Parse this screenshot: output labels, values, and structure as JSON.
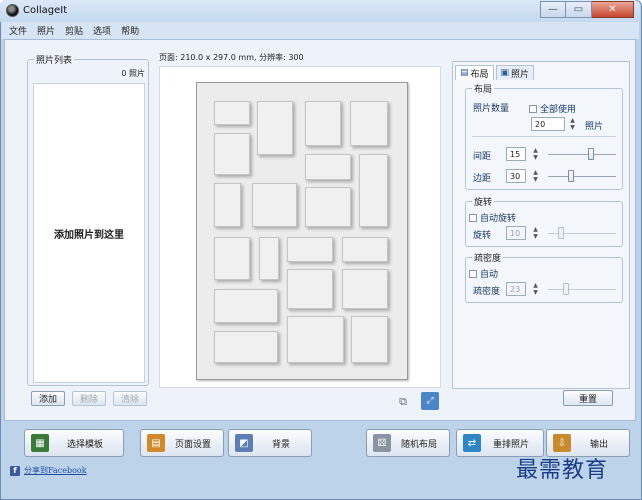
{
  "window": {
    "title": "CollageIt",
    "minimize": "—",
    "maximize": "▭",
    "close": "✕"
  },
  "menu": [
    "文件",
    "照片",
    "剪贴",
    "选项",
    "帮助"
  ],
  "photo_list": {
    "title": "照片列表",
    "count": "0 照片",
    "drop_hint": "添加照片到这里",
    "add": "添加",
    "remove": "删除",
    "clear": "清除"
  },
  "page_info": "页面: 210.0 x 297.0 mm, 分辨率: 300",
  "tabs": {
    "layout": "布局",
    "photo": "照片"
  },
  "layout_group": {
    "title": "布局",
    "photo_count_label": "照片数量",
    "use_all": "全部使用",
    "photo_count": "20",
    "photo_unit": "照片",
    "spacing_label": "间距",
    "spacing": "15",
    "margin_label": "边距",
    "margin": "30"
  },
  "rotation_group": {
    "title": "旋转",
    "auto": "自动旋转",
    "rotation_label": "旋转",
    "rotation": "10"
  },
  "density_group": {
    "title": "疏密度",
    "auto": "自动",
    "density_label": "疏密度",
    "density": "23"
  },
  "reset": "重置",
  "bottom": {
    "template": "选择模板",
    "page_setup": "页面设置",
    "background": "背景",
    "random_layout": "随机布局",
    "rearrange": "重排照片",
    "export": "输出"
  },
  "share": "分享到Facebook",
  "watermark": "最需教育",
  "icons": {
    "template": "template-icon",
    "page_setup": "page-setup-icon",
    "background": "background-icon",
    "random_layout": "dice-icon",
    "rearrange": "shuffle-icon",
    "export": "export-icon"
  }
}
